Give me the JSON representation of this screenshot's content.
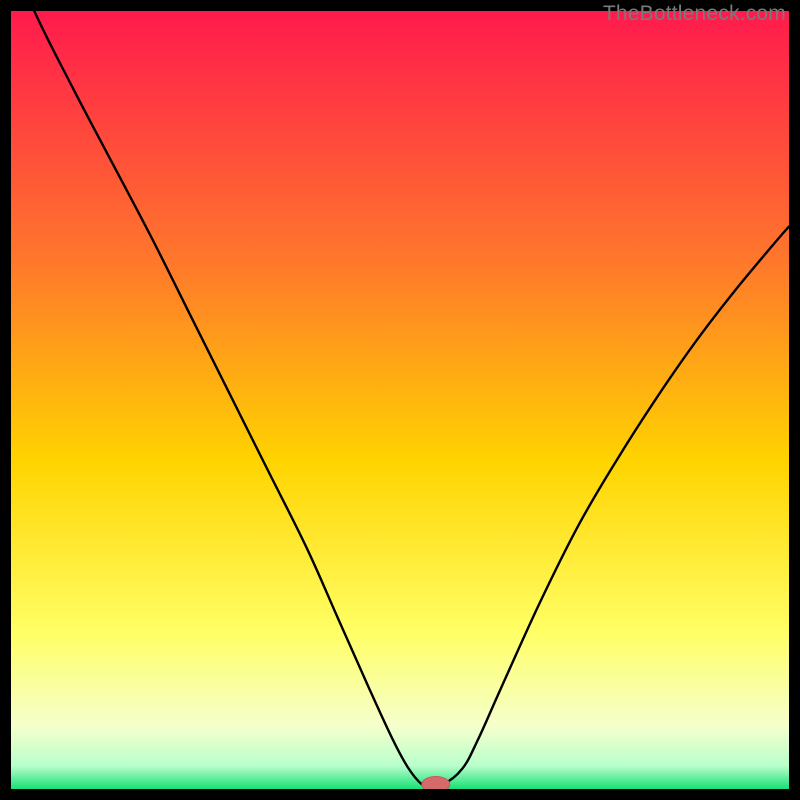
{
  "watermark": "TheBottleneck.com",
  "colors": {
    "frame": "#000000",
    "curve": "#000000",
    "marker_fill": "#d66a6a",
    "marker_stroke": "#c25a5a",
    "grad_top": "#ff1a4d",
    "grad_mid1": "#ff7a2a",
    "grad_mid2": "#ffd400",
    "grad_low1": "#ffff66",
    "grad_low2": "#f5ffcc",
    "grad_low3": "#b8ffcc",
    "grad_bottom": "#18e077"
  },
  "chart_data": {
    "type": "line",
    "title": "",
    "xlabel": "",
    "ylabel": "",
    "xlim": [
      0,
      100
    ],
    "ylim": [
      0,
      100
    ],
    "x": [
      0,
      3,
      8,
      13,
      18,
      23,
      28,
      33,
      38,
      42,
      46,
      49,
      51,
      52.8,
      53.6,
      55.5,
      58,
      60,
      63,
      68,
      73,
      78,
      83,
      88,
      93,
      98,
      100
    ],
    "values": [
      108,
      100,
      90,
      80.5,
      71,
      61,
      51,
      41,
      31,
      22,
      13,
      6.5,
      2.8,
      0.6,
      0.6,
      0.6,
      2.6,
      6.3,
      13,
      24,
      34,
      42.5,
      50.3,
      57.5,
      64,
      70,
      72.3
    ],
    "marker": {
      "x": 54.6,
      "y": 0.6,
      "rx": 1.8,
      "ry": 1.0
    },
    "flat_segment": {
      "x_start": 52.8,
      "x_end": 55.5,
      "y": 0.6
    }
  }
}
